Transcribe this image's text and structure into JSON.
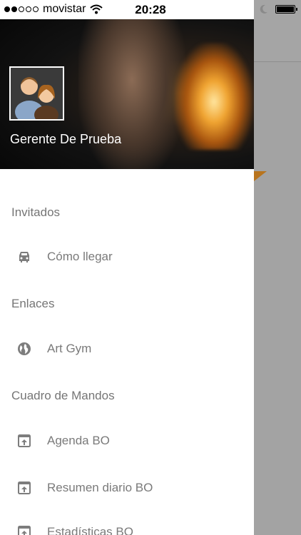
{
  "status_bar": {
    "carrier": "movistar",
    "time": "20:28"
  },
  "drawer": {
    "user_name": "Gerente De Prueba",
    "sections": [
      {
        "title": "Invitados",
        "items": [
          {
            "label": "Cómo llegar",
            "icon": "car-icon"
          }
        ]
      },
      {
        "title": "Enlaces",
        "items": [
          {
            "label": "Art Gym",
            "icon": "globe-icon"
          }
        ]
      },
      {
        "title": "Cuadro de Mandos",
        "items": [
          {
            "label": "Agenda BO",
            "icon": "open-in-app-icon"
          },
          {
            "label": "Resumen diario BO",
            "icon": "open-in-app-icon"
          },
          {
            "label": "Estadísticas BO",
            "icon": "open-in-app-icon"
          }
        ]
      }
    ]
  },
  "colors": {
    "overlay": "#a3a3a3",
    "accent": "#b8741e",
    "text_secondary": "#757575"
  }
}
